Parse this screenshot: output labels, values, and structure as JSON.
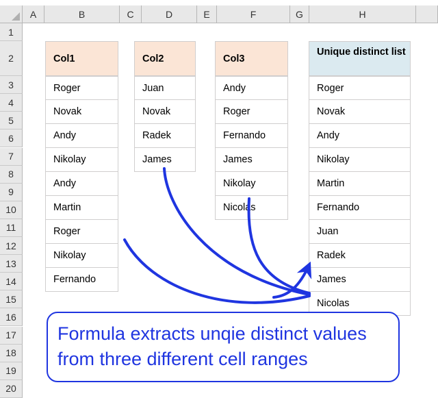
{
  "app": {
    "type": "spreadsheet",
    "name": "excel-worksheet"
  },
  "grid": {
    "column_headers": [
      "A",
      "B",
      "C",
      "D",
      "E",
      "F",
      "G",
      "H"
    ],
    "row_headers": [
      "1",
      "2",
      "3",
      "4",
      "5",
      "6",
      "7",
      "8",
      "9",
      "10",
      "11",
      "12",
      "13",
      "14",
      "15",
      "16",
      "17",
      "18",
      "19",
      "20"
    ],
    "select_all_icon": "select-all-triangle"
  },
  "colors": {
    "header_peach": "#FBE5D6",
    "header_blue": "#DBEAF0",
    "accent_blue": "#1F35E0",
    "grid_line": "#D0CECE",
    "heading_bg": "#E8E8E8"
  },
  "tables": {
    "col1": {
      "header": "Col1",
      "values": [
        "Roger",
        "Novak",
        "Andy",
        "Nikolay",
        "Andy",
        "Martin",
        "Roger",
        "Nikolay",
        "Fernando"
      ]
    },
    "col2": {
      "header": "Col2",
      "values": [
        "Juan",
        "Novak",
        "Radek",
        "James"
      ]
    },
    "col3": {
      "header": "Col3",
      "values": [
        "Andy",
        "Roger",
        "Fernando",
        "James",
        "Nikolay",
        "Nicolas"
      ]
    },
    "unique": {
      "header": "Unique distinct list",
      "values": [
        "Roger",
        "Novak",
        "Andy",
        "Nikolay",
        "Martin",
        "Fernando",
        "Juan",
        "Radek",
        "James",
        "Nicolas"
      ]
    }
  },
  "callout": {
    "text": "Formula extracts unqie distinct values from three different cell ranges"
  },
  "annotations": {
    "arrows": [
      {
        "name": "arrow-from-col1",
        "description": "curve from below Col1 table to unique list"
      },
      {
        "name": "arrow-from-col2",
        "description": "curve from below Col2 table to unique list"
      },
      {
        "name": "arrow-from-col3",
        "description": "curve from below Col3 table to unique list"
      }
    ]
  }
}
